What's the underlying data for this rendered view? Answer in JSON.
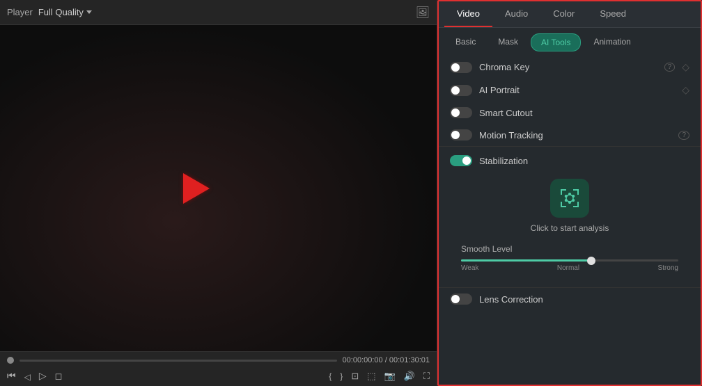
{
  "player": {
    "label": "Player",
    "quality": "Full Quality",
    "time_current": "00:00:00:00",
    "time_separator": "/",
    "time_total": "00:01:30:01"
  },
  "top_tabs": [
    {
      "id": "video",
      "label": "Video",
      "active": true
    },
    {
      "id": "audio",
      "label": "Audio",
      "active": false
    },
    {
      "id": "color",
      "label": "Color",
      "active": false
    },
    {
      "id": "speed",
      "label": "Speed",
      "active": false
    }
  ],
  "sub_tabs": [
    {
      "id": "basic",
      "label": "Basic",
      "active": false
    },
    {
      "id": "mask",
      "label": "Mask",
      "active": false
    },
    {
      "id": "ai_tools",
      "label": "AI Tools",
      "active": true
    },
    {
      "id": "animation",
      "label": "Animation",
      "active": false
    }
  ],
  "tools": [
    {
      "id": "chroma_key",
      "label": "Chroma Key",
      "has_help": true,
      "has_reset": true,
      "toggle_on": false
    },
    {
      "id": "ai_portrait",
      "label": "AI Portrait",
      "has_help": false,
      "has_reset": true,
      "toggle_on": false
    },
    {
      "id": "smart_cutout",
      "label": "Smart Cutout",
      "has_help": false,
      "has_reset": false,
      "toggle_on": false
    },
    {
      "id": "motion_tracking",
      "label": "Motion Tracking",
      "has_help": true,
      "has_reset": false,
      "toggle_on": false
    }
  ],
  "stabilization": {
    "label": "Stabilization",
    "toggle_on": true,
    "analysis_text": "Click to start analysis",
    "smooth_level_label": "Smooth Level",
    "smooth_labels": {
      "weak": "Weak",
      "normal": "Normal",
      "strong": "Strong"
    }
  },
  "lens_correction": {
    "label": "Lens Correction",
    "toggle_on": false
  },
  "controls": {
    "time_current": "00:00:00:00",
    "time_separator": "/",
    "time_total": "00:01:30:01"
  },
  "icons": {
    "image_icon": "🖼",
    "help_circle": "?",
    "reset_icon": "◇",
    "analysis_icon_unicode": "⬡"
  }
}
